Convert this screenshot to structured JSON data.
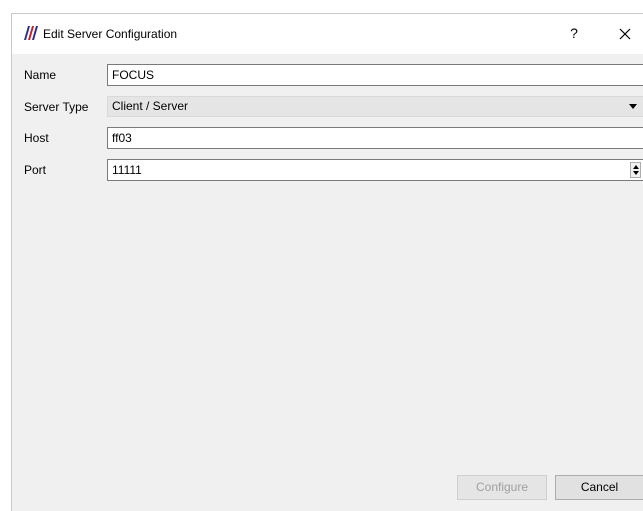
{
  "window": {
    "title": "Edit Server Configuration",
    "help_glyph": "?",
    "close_icon": "close-icon",
    "app_icon_colors": [
      "#2f2f86",
      "#c21f2f",
      "#2f2f86"
    ]
  },
  "form": {
    "name_label": "Name",
    "name_value": "FOCUS",
    "server_type_label": "Server Type",
    "server_type_value": "Client / Server",
    "host_label": "Host",
    "host_value": "ff03",
    "port_label": "Port",
    "port_value": "11111"
  },
  "buttons": {
    "configure_label": "Configure",
    "cancel_label": "Cancel"
  }
}
